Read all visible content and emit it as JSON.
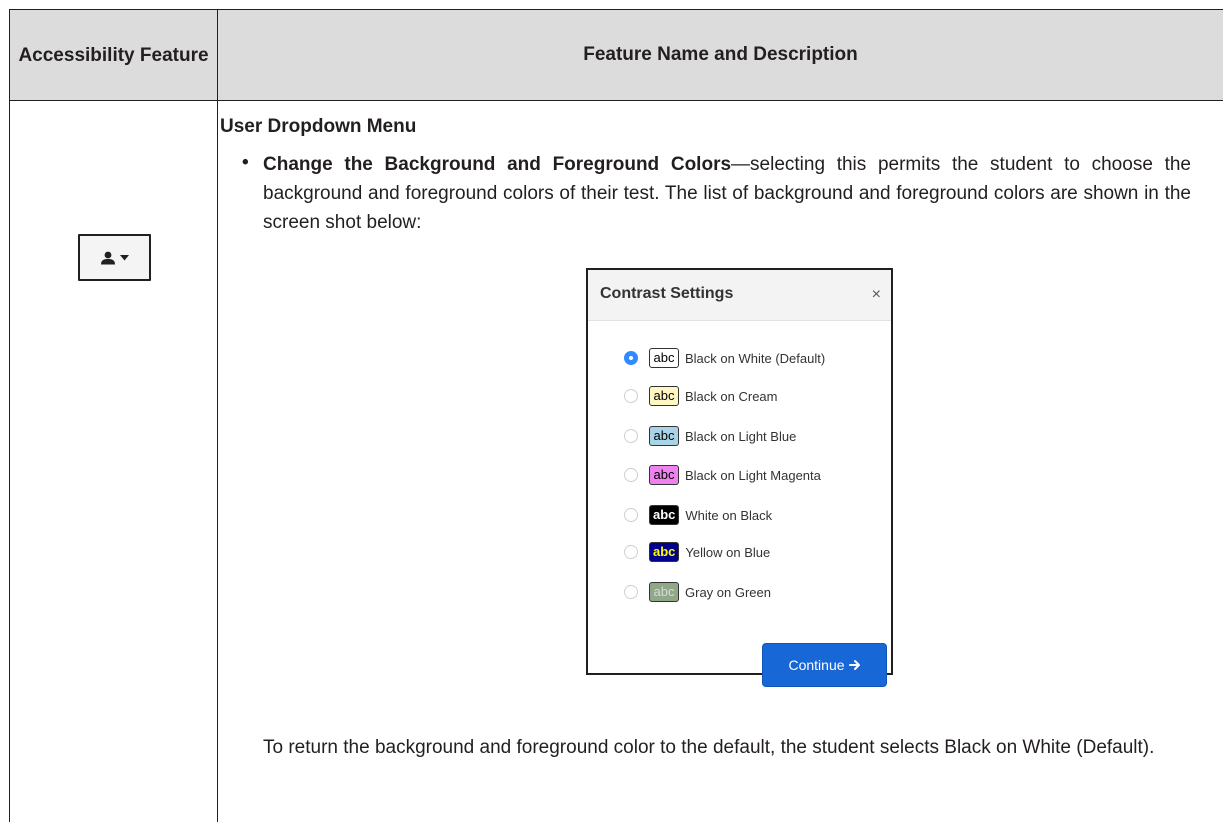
{
  "table": {
    "header_col1": "Accessibility Feature",
    "header_col2": "Feature Name and Description"
  },
  "section": {
    "title": "User Dropdown Menu",
    "bullet_bold": "Change the Background and Foreground Colors",
    "bullet_text": "—selecting this permits the student to choose the background and foreground colors of their test. The list of background and foreground colors are shown in the screen shot below:",
    "footer": "To return the background and foreground color to the default, the student selects Black on White (Default)."
  },
  "dialog": {
    "title": "Contrast Settings",
    "close": "×",
    "swatch_text": "abc",
    "options": [
      {
        "label": "Black on White (Default)",
        "checked": true,
        "bg": "#ffffff",
        "fg": "#000000"
      },
      {
        "label": "Black on Cream",
        "checked": false,
        "bg": "#fff6c2",
        "fg": "#000000"
      },
      {
        "label": "Black on Light Blue",
        "checked": false,
        "bg": "#a9d4e8",
        "fg": "#000000"
      },
      {
        "label": "Black on Light Magenta",
        "checked": false,
        "bg": "#ee82ee",
        "fg": "#000000"
      },
      {
        "label": "White on Black",
        "checked": false,
        "bg": "#000000",
        "fg": "#ffffff"
      },
      {
        "label": "Yellow on Blue",
        "checked": false,
        "bg": "#00008b",
        "fg": "#ffff00"
      },
      {
        "label": "Gray on Green",
        "checked": false,
        "bg": "#8fa887",
        "fg": "#d9d9d9"
      }
    ],
    "continue_label": "Continue",
    "continue_icon": "arrow-right-icon"
  },
  "user_button": {
    "icon": "user-icon",
    "caret": "caret-down-icon"
  }
}
